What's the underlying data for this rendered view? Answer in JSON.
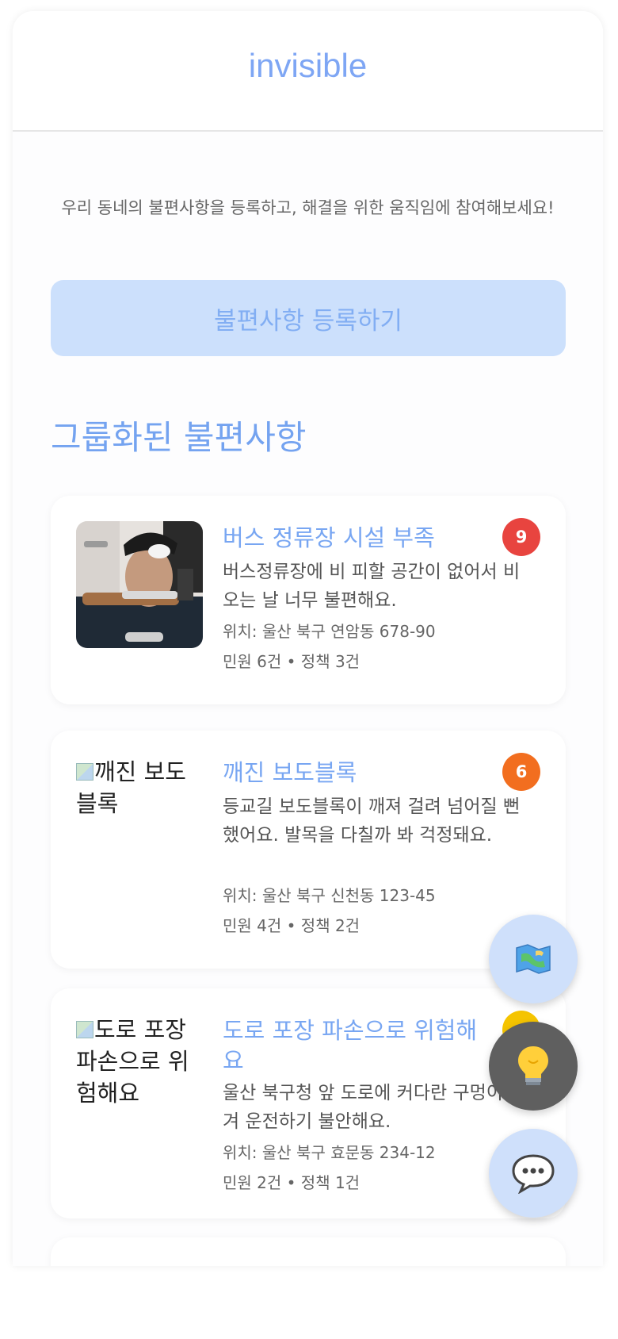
{
  "app": {
    "brand": "invisible"
  },
  "intro": {
    "text": "우리 동네의 불편사항을 등록하고, 해결을 위한 움직임에 참여해보세요!"
  },
  "cta": {
    "label": "불편사항 등록하기"
  },
  "section": {
    "title": "그룹화된 불편사항"
  },
  "cards": [
    {
      "title": "버스 정류장 시설 부족",
      "desc": "버스정류장에 비 피할 공간이 없어서 비 오는 날 너무 불편해요.",
      "location": "위치: 울산 북구 연암동 678-90",
      "stats": "민원 6건 • 정책 3건",
      "count": "9",
      "badge_color": "#e8443f"
    },
    {
      "title": "깨진 보도블록",
      "image_alt": "깨진 보도블록",
      "desc": "등교길 보도블록이 깨져 걸려 넘어질 뻔 했어요. 발목을 다칠까 봐 걱정돼요.",
      "location": "위치: 울산 북구 신천동 123-45",
      "stats": "민원 4건 • 정책 2건",
      "count": "6",
      "badge_color": "#f26e1f"
    },
    {
      "title": "도로 포장 파손으로 위험해요",
      "image_alt": "도로 포장 파손으로 위험해요",
      "desc": "울산 북구청 앞 도로에 커다란 구멍이 생겨 운전하기 불안해요.",
      "location": "위치: 울산 북구 효문동 234-12",
      "stats": "민원 2건 • 정책 1건",
      "badge_color": "#f5c400"
    }
  ],
  "fabs": {
    "map_icon": "map-icon",
    "idea_icon": "lightbulb-icon",
    "chat_icon": "chat-bubble-icon"
  }
}
